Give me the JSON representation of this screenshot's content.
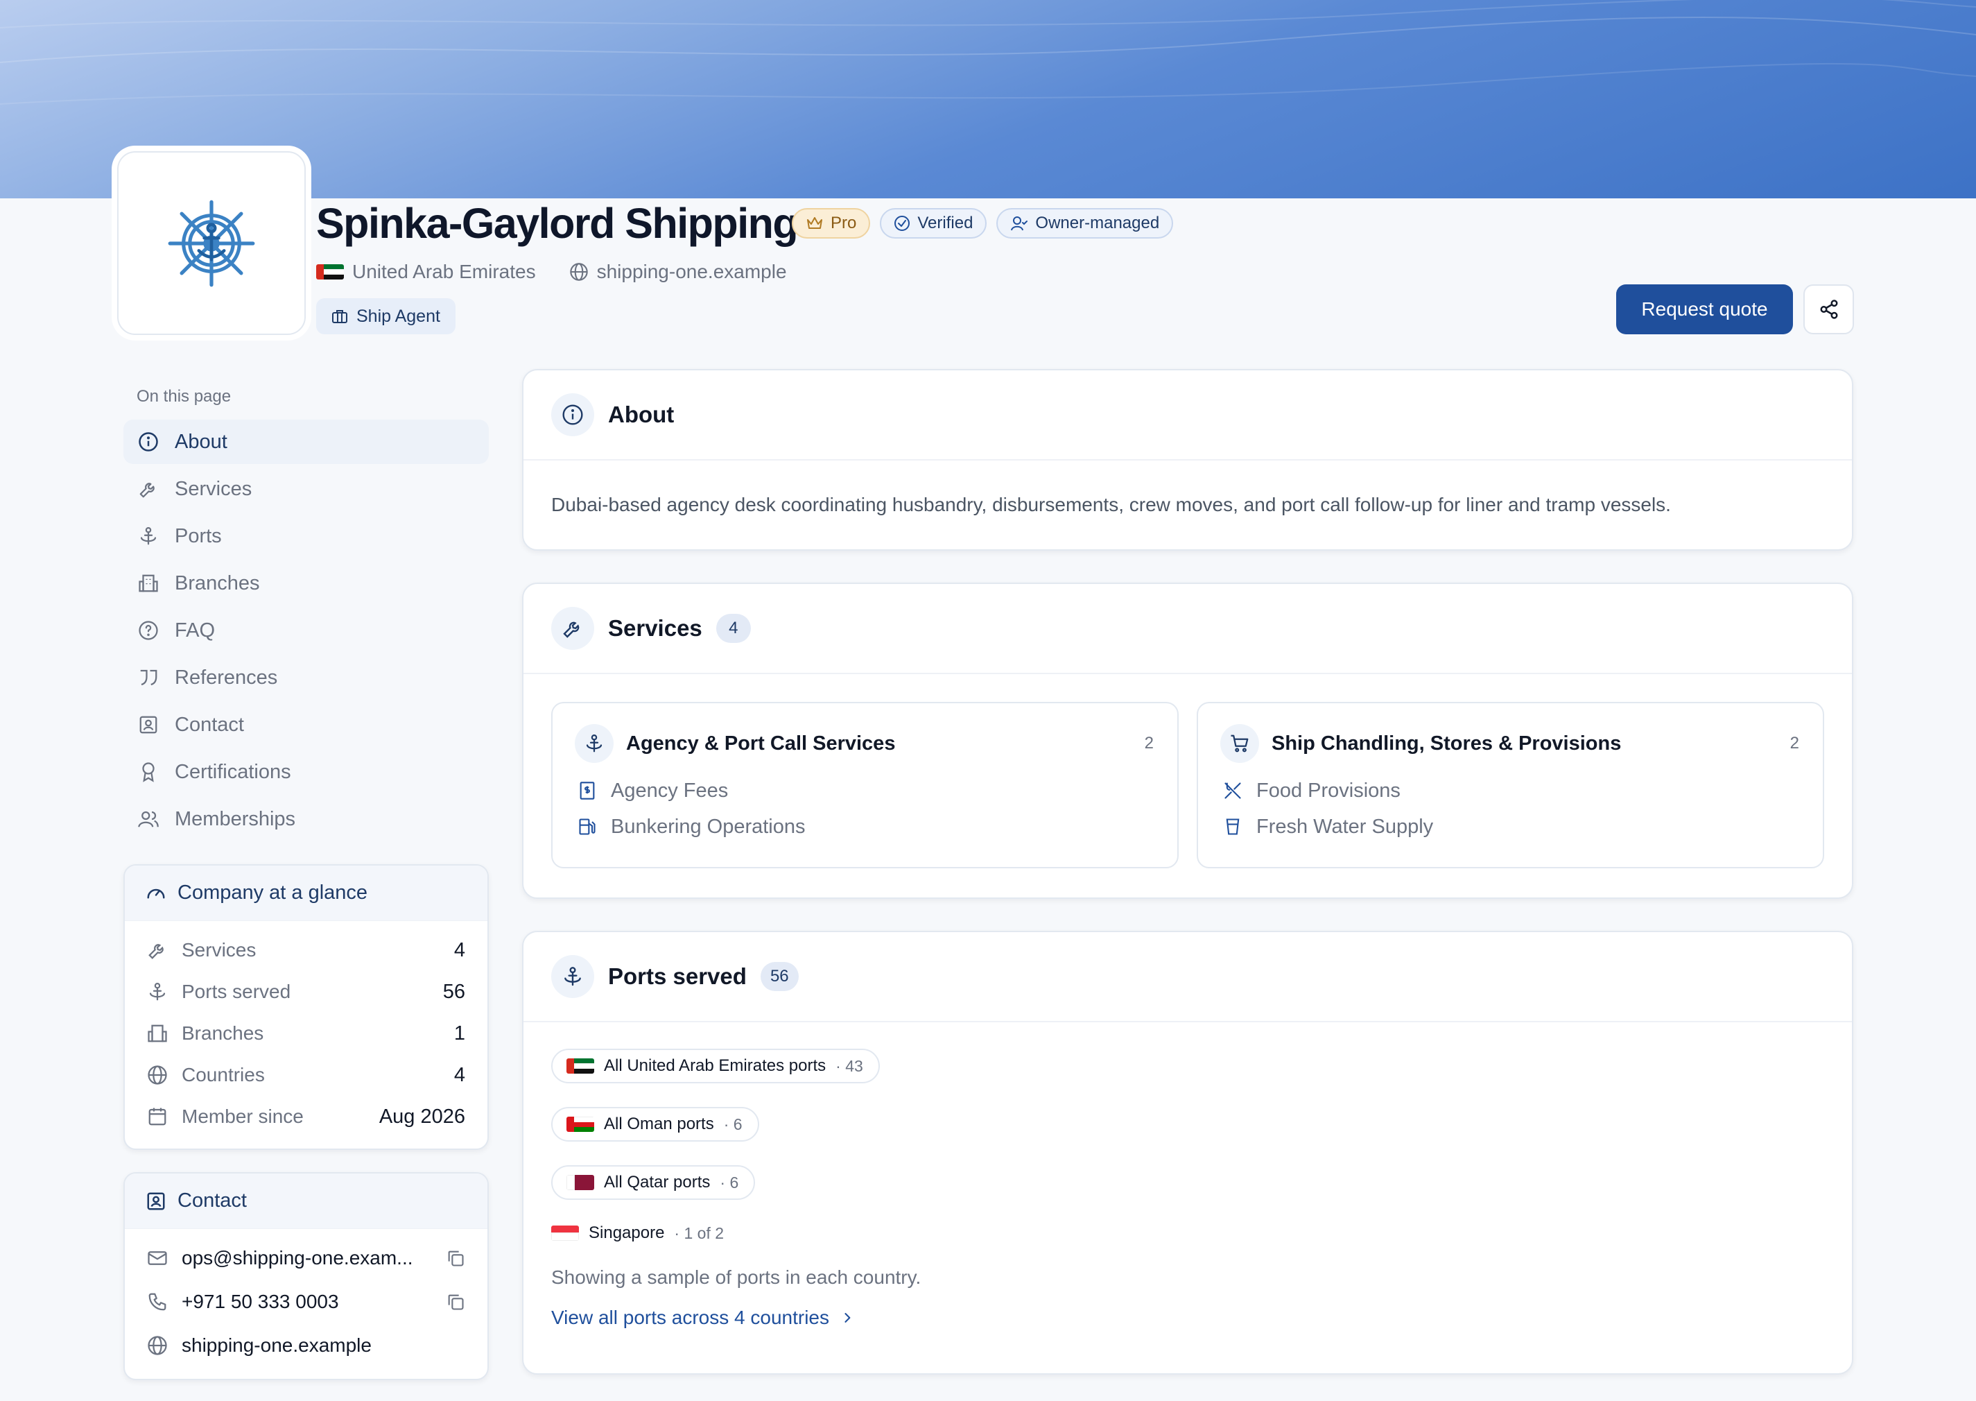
{
  "company": {
    "name": "Spinka-Gaylord Shipping",
    "badges": {
      "pro": "Pro",
      "verified": "Verified",
      "owner": "Owner-managed"
    },
    "country": "United Arab Emirates",
    "website": "shipping-one.example",
    "role": "Ship Agent"
  },
  "actions": {
    "quote": "Request quote"
  },
  "sidebar": {
    "heading": "On this page",
    "items": [
      {
        "label": "About",
        "icon": "info-icon"
      },
      {
        "label": "Services",
        "icon": "wrench-icon"
      },
      {
        "label": "Ports",
        "icon": "anchor-icon"
      },
      {
        "label": "Branches",
        "icon": "building-icon"
      },
      {
        "label": "FAQ",
        "icon": "question-icon"
      },
      {
        "label": "References",
        "icon": "quote-icon"
      },
      {
        "label": "Contact",
        "icon": "contact-card-icon"
      },
      {
        "label": "Certifications",
        "icon": "award-icon"
      },
      {
        "label": "Memberships",
        "icon": "users-icon"
      }
    ]
  },
  "glance": {
    "title": "Company at a glance",
    "rows": [
      {
        "label": "Services",
        "value": "4"
      },
      {
        "label": "Ports served",
        "value": "56"
      },
      {
        "label": "Branches",
        "value": "1"
      },
      {
        "label": "Countries",
        "value": "4"
      },
      {
        "label": "Member since",
        "value": "Aug 2026"
      }
    ]
  },
  "contact": {
    "title": "Contact",
    "email": "ops@shipping-one.exam...",
    "phone": "+971 50 333 0003",
    "website": "shipping-one.example"
  },
  "about": {
    "title": "About",
    "text": "Dubai-based agency desk coordinating husbandry, disbursements, crew moves, and port call follow-up for liner and tramp vessels."
  },
  "services": {
    "title": "Services",
    "count": "4",
    "groups": [
      {
        "name": "Agency & Port Call Services",
        "count": "2",
        "items": [
          "Agency Fees",
          "Bunkering Operations"
        ]
      },
      {
        "name": "Ship Chandling, Stores & Provisions",
        "count": "2",
        "items": [
          "Food Provisions",
          "Fresh Water Supply"
        ]
      }
    ]
  },
  "ports": {
    "title": "Ports served",
    "count": "56",
    "groups": [
      {
        "label": "All United Arab Emirates ports",
        "count": "· 43"
      },
      {
        "label": "All Oman ports",
        "count": "· 6"
      },
      {
        "label": "All Qatar ports",
        "count": "· 6"
      }
    ],
    "single": {
      "label": "Singapore",
      "count": "· 1 of 2"
    },
    "note": "Showing a sample of ports in each country.",
    "link": "View all ports across 4 countries"
  },
  "colors": {
    "accent": "#1f4f9c",
    "banner": "#3d72c6",
    "pro": "#fbeed6"
  }
}
